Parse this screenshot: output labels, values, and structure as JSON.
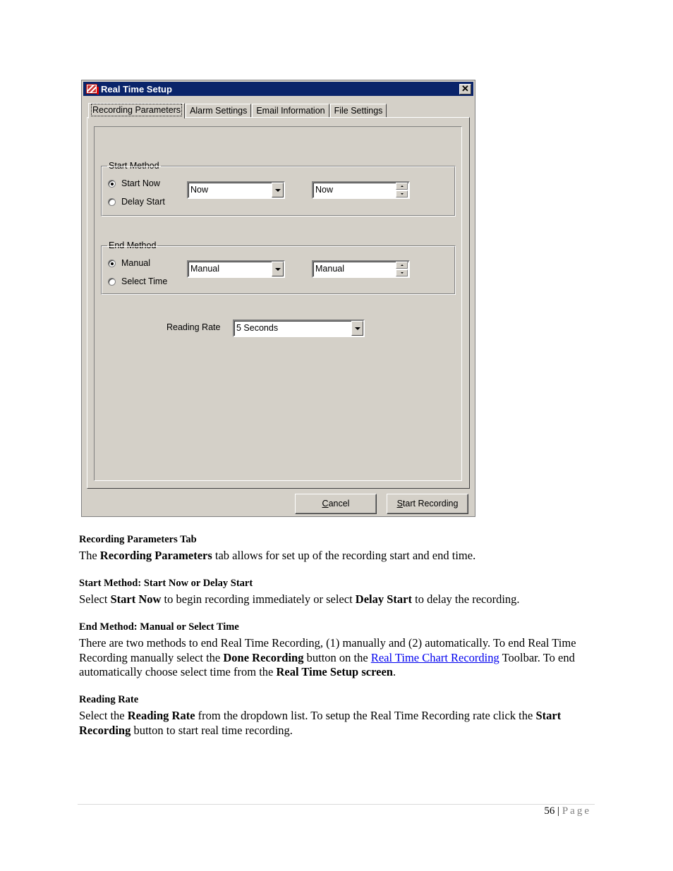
{
  "dialog": {
    "title": "Real Time Setup",
    "close_label": "✕",
    "tabs": [
      {
        "label": "Recording Parameters",
        "active": true
      },
      {
        "label": "Alarm Settings",
        "active": false
      },
      {
        "label": "Email Information",
        "active": false
      },
      {
        "label": "File Settings",
        "active": false
      }
    ],
    "start_method": {
      "legend": "Start Method",
      "options": [
        {
          "label": "Start Now",
          "checked": true
        },
        {
          "label": "Delay Start",
          "checked": false
        }
      ],
      "date_combo_value": "Now",
      "time_spin_value": "Now"
    },
    "end_method": {
      "legend": "End Method",
      "options": [
        {
          "label": "Manual",
          "checked": true
        },
        {
          "label": "Select Time",
          "checked": false
        }
      ],
      "date_combo_value": "Manual",
      "time_spin_value": "Manual"
    },
    "reading_rate": {
      "label": "Reading Rate",
      "value": "5 Seconds"
    },
    "buttons": {
      "cancel_mnemonic": "C",
      "cancel_rest": "ancel",
      "start_mnemonic": "S",
      "start_rest": "tart Recording"
    }
  },
  "document": {
    "sections": [
      {
        "heading": "Recording Parameters Tab",
        "p1": "The ",
        "b1": "Recording Parameters",
        "p2": " tab allows for set up of the recording start and end time."
      },
      {
        "heading": "Start Method: Start Now or Delay Start",
        "p1": "Select ",
        "b1": "Start Now",
        "p2": " to begin recording immediately or select ",
        "b2": "Delay Start",
        "p3": " to delay the recording."
      },
      {
        "heading": "End Method: Manual or Select Time",
        "p1": "There are two methods to end Real Time Recording, (1) manually and (2) automatically. To end Real Time Recording manually select the ",
        "b1": "Done Recording",
        "p2": " button on the ",
        "link": "Real Time Chart Recording",
        "p3": " Toolbar. To end automatically choose select time from the ",
        "b2": "Real Time Setup screen",
        "p4": "."
      },
      {
        "heading": "Reading Rate",
        "p1": "Select the ",
        "b1": "Reading Rate",
        "p2": " from the dropdown list. To setup the Real Time Recording rate click the ",
        "b2": "Start Recording",
        "p3": " button to start real time recording."
      }
    ],
    "footer": {
      "page_number": "56",
      "separator": " | ",
      "page_word": "Page"
    }
  }
}
